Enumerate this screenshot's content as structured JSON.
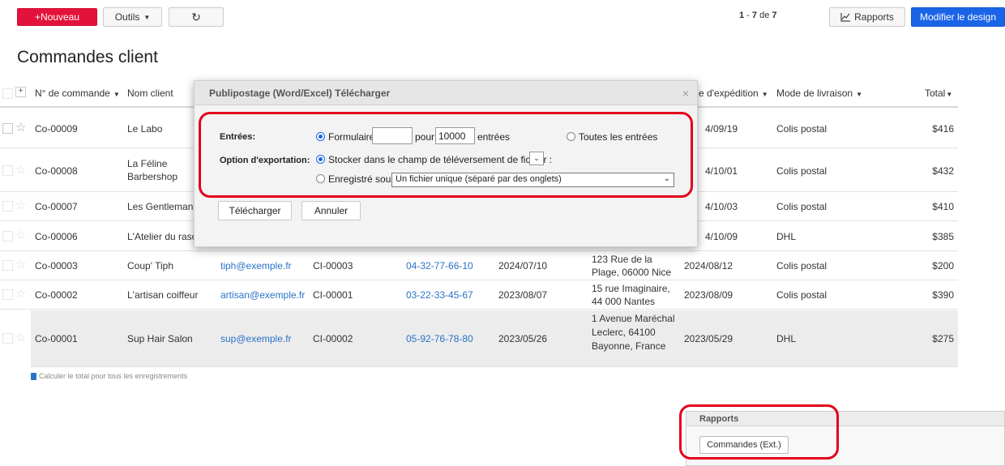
{
  "toolbar": {
    "new_label": "+Nouveau",
    "tools_label": "Outils",
    "refresh_icon": "↻",
    "pager_from": "1",
    "pager_to": "7",
    "pager_of": "de",
    "pager_total": "7",
    "reports_label": "Rapports",
    "design_label": "Modifier le design"
  },
  "page": {
    "title": "Commandes client"
  },
  "table": {
    "headers": {
      "order_no": "N° de commande",
      "client": "Nom client",
      "ship_date": "e d'expédition",
      "delivery": "Mode de livraison",
      "total": "Total"
    },
    "rows": [
      {
        "order": "Co-00009",
        "client": "Le Labo",
        "ship": "4/09/19",
        "mode": "Colis postal",
        "total": "$416"
      },
      {
        "order": "Co-00008",
        "client": "La Féline Barbershop",
        "ship": "4/10/01",
        "mode": "Colis postal",
        "total": "$432"
      },
      {
        "order": "Co-00007",
        "client": "Les Gentleman",
        "ship": "4/10/03",
        "mode": "Colis postal",
        "total": "$410"
      },
      {
        "order": "Co-00006",
        "client": "L'Atelier du raso",
        "ship": "4/10/09",
        "mode": "DHL",
        "total": "$385"
      },
      {
        "order": "Co-00003",
        "client": "Coup' Tiph",
        "email": "tiph@exemple.fr",
        "cid": "CI-00003",
        "phone": "04-32-77-66-10",
        "date": "2024/07/10",
        "addr": "123 Rue de la Plage, 06000 Nice",
        "ship": "2024/08/12",
        "mode": "Colis postal",
        "total": "$200"
      },
      {
        "order": "Co-00002",
        "client": "L'artisan coiffeur",
        "email": "artisan@exemple.fr",
        "cid": "CI-00001",
        "phone": "03-22-33-45-67",
        "date": "2023/08/07",
        "addr": "15 rue Imaginaire, 44 000 Nantes",
        "ship": "2023/08/09",
        "mode": "Colis postal",
        "total": "$390"
      },
      {
        "order": "Co-00001",
        "client": "Sup Hair Salon",
        "email": "sup@exemple.fr",
        "cid": "CI-00002",
        "phone": "05-92-76-78-80",
        "date": "2023/05/26",
        "addr": "1 Avenue Maréchal Leclerc, 64100 Bayonne, France",
        "ship": "2023/05/29",
        "mode": "DHL",
        "total": "$275"
      }
    ],
    "calc_total_label": "Calculer le total pour tous les enregistrements"
  },
  "reports_panel": {
    "title": "Rapports",
    "button": "Commandes (Ext.)"
  },
  "modal": {
    "title": "Publipostage (Word/Excel) Télécharger",
    "close_icon": "×",
    "entries_label": "Entrées:",
    "radio_form_label": "Formulaire",
    "form_from_value": "",
    "for_label": "pour",
    "form_count_value": "10000",
    "entries_suffix": "entrées",
    "radio_all_label": "Toutes les entrées",
    "export_label": "Option d'exportation:",
    "radio_store_label": "Stocker dans le champ de téléversement de fichier :",
    "radio_saved_label": "Enregistré sous",
    "saved_select_value": "Un fichier unique (séparé par des onglets)",
    "download_button": "Télécharger",
    "cancel_button": "Annuler"
  },
  "colors": {
    "brand_red": "#e3123a",
    "primary_blue": "#1a64e8",
    "highlight_red": "#e3001b",
    "link_blue": "#2a73c6"
  }
}
